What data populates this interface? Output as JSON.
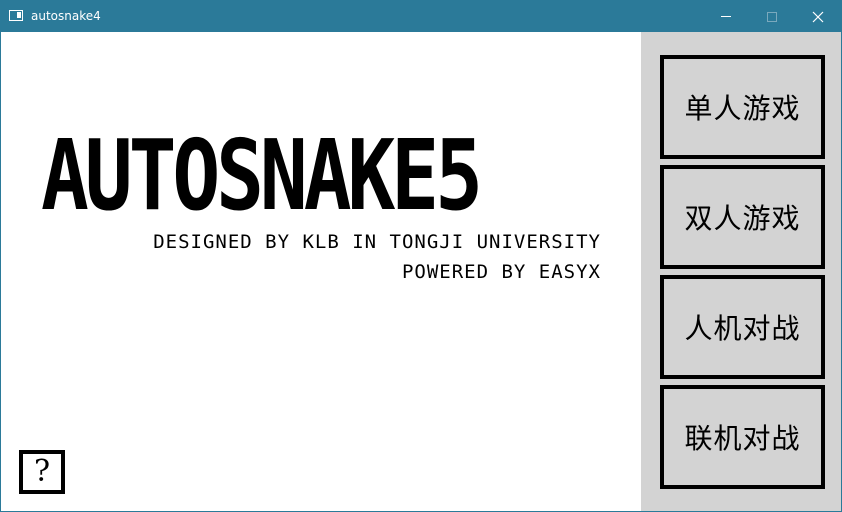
{
  "window": {
    "title": "autosnake4",
    "accent_color": "#2b7a99"
  },
  "titlebar_controls": {
    "minimize": "minimize-icon",
    "maximize": "maximize-icon",
    "close": "close-icon"
  },
  "splash": {
    "title": "AUTOSNAKE5",
    "credit_line_1": "DESIGNED BY KLB IN TONGJI UNIVERSITY",
    "credit_line_2": "POWERED BY EASYX"
  },
  "help": {
    "label": "?"
  },
  "menu": {
    "panel_color": "#d3d3d3",
    "items": [
      {
        "label": "单人游戏"
      },
      {
        "label": "双人游戏"
      },
      {
        "label": "人机对战"
      },
      {
        "label": "联机对战"
      }
    ]
  }
}
